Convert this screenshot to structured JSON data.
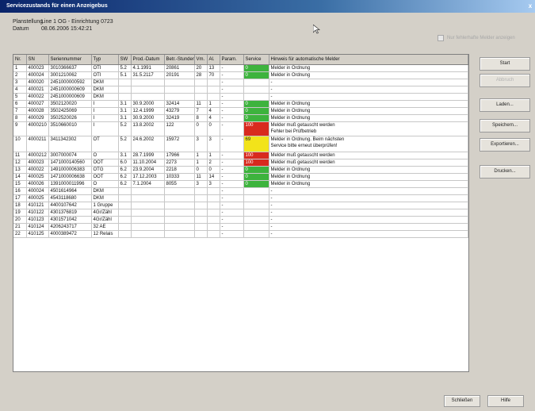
{
  "window": {
    "title": "Servicezustands für einen Anzeigebus",
    "close_label": "x"
  },
  "info": {
    "location_label": "Planstellung",
    "location_value": "Line 1 OG - Einrichtung 0723",
    "date_label": "Datum",
    "date_value": "08.06.2006 15:42:21"
  },
  "option_label": "Nur fehlerhafte Melder anzeigen",
  "columns": [
    "Nr.",
    "SN",
    "Seriennummer",
    "Typ",
    "SW",
    "Prod.-Datum",
    "Betr.-Stunden",
    "Vm.",
    "Al.",
    "Param.",
    "Service",
    "Hinweis für automatische Melder"
  ],
  "rows": [
    {
      "cells": [
        "1",
        "400023",
        "3010366637",
        "OTI",
        "5.2",
        "4.1.1991",
        "20861",
        "20",
        "13",
        "-",
        "0",
        "Melder in Ordnung"
      ],
      "status": "green"
    },
    {
      "cells": [
        "2",
        "400024",
        "3001210062",
        "OTI",
        "5.1",
        "31.5.2117",
        "20191",
        "28",
        "70",
        "-",
        "0",
        "Melder in Ordnung"
      ],
      "status": "green"
    },
    {
      "cells": [
        "3",
        "400020",
        "2451000000592",
        "DKM",
        "",
        "",
        "",
        "",
        "",
        "-",
        "",
        "-"
      ],
      "status": ""
    },
    {
      "cells": [
        "4",
        "400021",
        "2451000000609",
        "DKM",
        "",
        "",
        "",
        "",
        "",
        "-",
        "",
        "-"
      ],
      "status": ""
    },
    {
      "cells": [
        "5",
        "400022",
        "2451000000609",
        "DKM",
        "",
        "",
        "",
        "",
        "",
        "-",
        "",
        "-"
      ],
      "status": ""
    },
    {
      "cells": [
        "6",
        "400027",
        "3502120020",
        "I",
        "3.1",
        "30.9.2000",
        "32414",
        "11",
        "1",
        "-",
        "0",
        "Melder in Ordnung"
      ],
      "status": "green"
    },
    {
      "cells": [
        "7",
        "400028",
        "3502425069",
        "I",
        "3.1",
        "12.4.1999",
        "43279",
        "7",
        "4",
        "-",
        "0",
        "Melder in Ordnung"
      ],
      "status": "green"
    },
    {
      "cells": [
        "8",
        "400029",
        "3502520026",
        "I",
        "3.1",
        "30.9.2000",
        "32419",
        "8",
        "4",
        "-",
        "0",
        "Melder in Ordnung"
      ],
      "status": "green"
    },
    {
      "cells": [
        "9",
        "4000210",
        "3510660010",
        "I",
        "5.2",
        "13.8.2002",
        "122",
        "0",
        "0",
        "-",
        "100",
        "Melder muß getauscht werden\nFehler bei Prüfbetrieb"
      ],
      "status": "red"
    },
    {
      "cells": [
        "10",
        "4000211",
        "3411342302",
        "OT",
        "5.2",
        "24.6.2002",
        "15972",
        "3",
        "3",
        "-",
        "69",
        "Melder in Ordnung. Beim nächsten\nService bitte erneut überprüfen!"
      ],
      "status": "yellow"
    },
    {
      "cells": [
        "11",
        "4000212",
        "3007000074",
        "O",
        "3.1",
        "28.7.1999",
        "17966",
        "1",
        "1",
        "-",
        "100",
        "Melder muß getauscht werden"
      ],
      "status": "red"
    },
    {
      "cells": [
        "12",
        "400023",
        "1471000140560",
        "OOT",
        "6.0",
        "11.10.2004",
        "2273",
        "1",
        "2",
        "-",
        "100",
        "Melder muß getauscht werden"
      ],
      "status": "red"
    },
    {
      "cells": [
        "13",
        "400022",
        "1491000006383",
        "OTG",
        "6.2",
        "23.9.2004",
        "2218",
        "0",
        "0",
        "-",
        "0",
        "Melder in Ordnung"
      ],
      "status": "green"
    },
    {
      "cells": [
        "14",
        "400025",
        "1471000006638",
        "OOT",
        "6.2",
        "17.12.2003",
        "10333",
        "11",
        "14",
        "-",
        "0",
        "Melder in Ordnung"
      ],
      "status": "green"
    },
    {
      "cells": [
        "15",
        "400026",
        "1391000011996",
        "O",
        "6.2",
        "7.1.2004",
        "8055",
        "3",
        "3",
        "-",
        "0",
        "Melder in Ordnung"
      ],
      "status": "green"
    },
    {
      "cells": [
        "16",
        "400024",
        "4501614964",
        "DKM",
        "",
        "",
        "",
        "",
        "",
        "-",
        "",
        "-"
      ],
      "status": ""
    },
    {
      "cells": [
        "17",
        "400025",
        "4543118680",
        "DKM",
        "",
        "",
        "",
        "",
        "",
        "-",
        "",
        "-"
      ],
      "status": ""
    },
    {
      "cells": [
        "18",
        "410121",
        "4400107642",
        "1 Gruppe",
        "",
        "",
        "",
        "",
        "",
        "-",
        "",
        "-"
      ],
      "status": ""
    },
    {
      "cells": [
        "19",
        "410122",
        "4301376819",
        "4Gr/Zähl",
        "",
        "",
        "",
        "",
        "",
        "-",
        "",
        "-"
      ],
      "status": ""
    },
    {
      "cells": [
        "20",
        "410123",
        "4301571042",
        "4Gr/Zähl",
        "",
        "",
        "",
        "",
        "",
        "-",
        "",
        "-"
      ],
      "status": ""
    },
    {
      "cells": [
        "21",
        "410124",
        "4206243717",
        "32 AE",
        "",
        "",
        "",
        "",
        "",
        "-",
        "",
        "-"
      ],
      "status": ""
    },
    {
      "cells": [
        "22",
        "410125",
        "4000389472",
        "12 Relais",
        "",
        "",
        "",
        "",
        "",
        "-",
        "",
        "-"
      ],
      "status": ""
    }
  ],
  "buttons": {
    "start": "Start",
    "abbruch": "Abbruch",
    "laden": "Laden...",
    "speichern": "Speichern...",
    "exportieren": "Exportieren...",
    "drucken": "Drucken...",
    "schliessen": "Schließen",
    "hilfe": "Hilfe"
  },
  "colors": {
    "ok": "#3db33d",
    "error": "#d82a1e",
    "warning": "#f2e31a",
    "title_bar": "#0a246a"
  },
  "icons": {
    "cursor": "mouse-pointer-icon"
  }
}
